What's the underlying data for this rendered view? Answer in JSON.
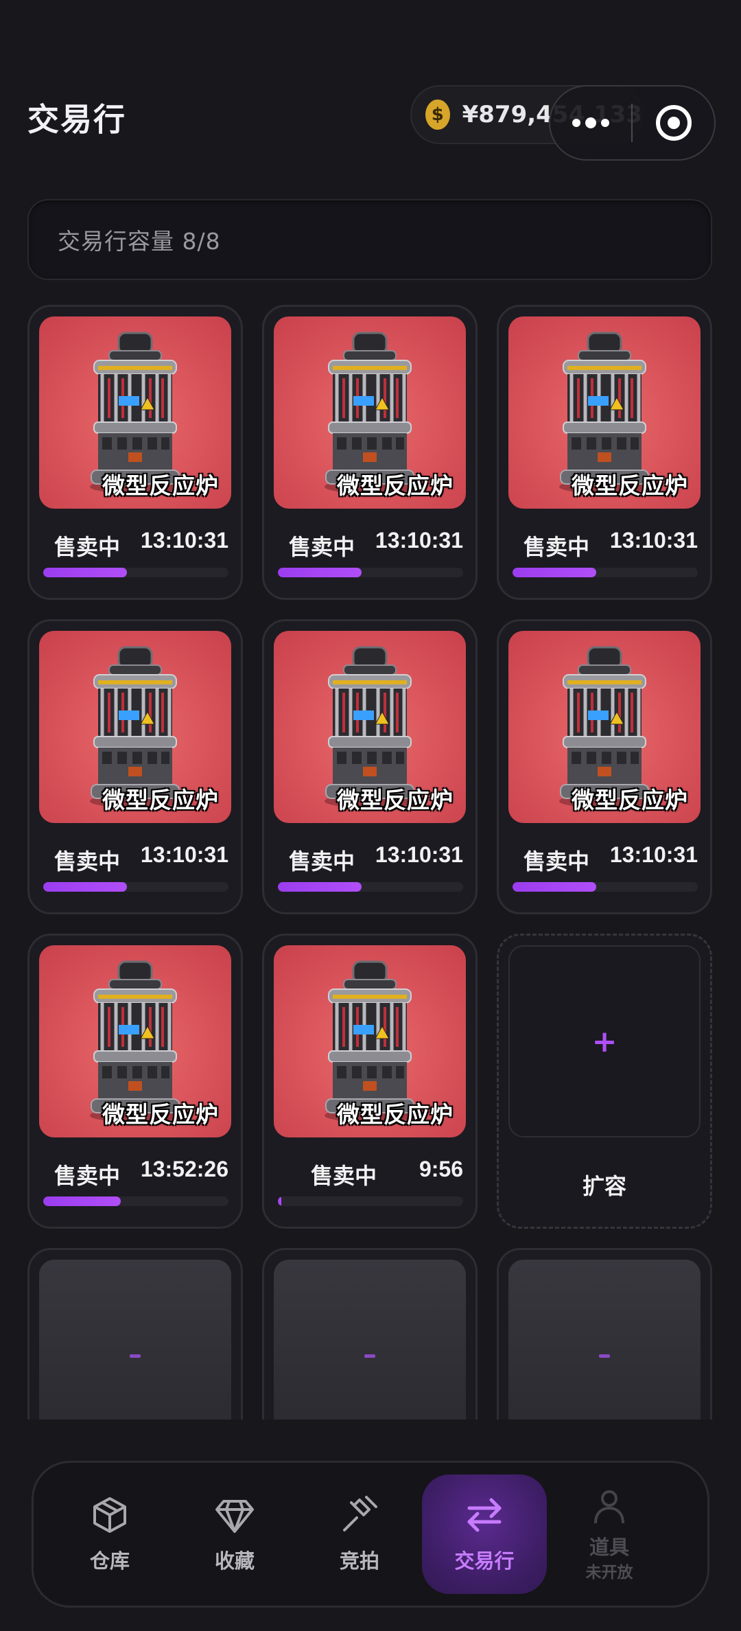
{
  "header": {
    "title": "交易行",
    "balance": "¥879,454,133",
    "coin_symbol": "$"
  },
  "capacity": {
    "text": "交易行容量 8/8"
  },
  "slots": [
    {
      "name": "微型反应炉",
      "status": "售卖中",
      "time": "13:10:31",
      "progress": 0.45
    },
    {
      "name": "微型反应炉",
      "status": "售卖中",
      "time": "13:10:31",
      "progress": 0.45
    },
    {
      "name": "微型反应炉",
      "status": "售卖中",
      "time": "13:10:31",
      "progress": 0.45
    },
    {
      "name": "微型反应炉",
      "status": "售卖中",
      "time": "13:10:31",
      "progress": 0.45
    },
    {
      "name": "微型反应炉",
      "status": "售卖中",
      "time": "13:10:31",
      "progress": 0.45
    },
    {
      "name": "微型反应炉",
      "status": "售卖中",
      "time": "13:10:31",
      "progress": 0.45
    },
    {
      "name": "微型反应炉",
      "status": "售卖中",
      "time": "13:52:26",
      "progress": 0.42
    },
    {
      "name": "微型反应炉",
      "status": "售卖中",
      "time": "9:56",
      "progress": 0.02
    }
  ],
  "expand_slot": {
    "label": "扩容",
    "icon": "plus-icon"
  },
  "nav": {
    "items": [
      {
        "label": "仓库",
        "icon": "box-icon",
        "active": false
      },
      {
        "label": "收藏",
        "icon": "diamond-icon",
        "active": false
      },
      {
        "label": "竞拍",
        "icon": "gavel-icon",
        "active": false
      },
      {
        "label": "交易行",
        "icon": "swap-icon",
        "active": true
      },
      {
        "label": "道具",
        "sublabel": "未开放",
        "icon": "user-icon",
        "active": false
      }
    ]
  },
  "colors": {
    "accent": "#b04ef7",
    "background": "#18171c",
    "item_bg": "#d8525a",
    "coin": "#d6a52a"
  }
}
